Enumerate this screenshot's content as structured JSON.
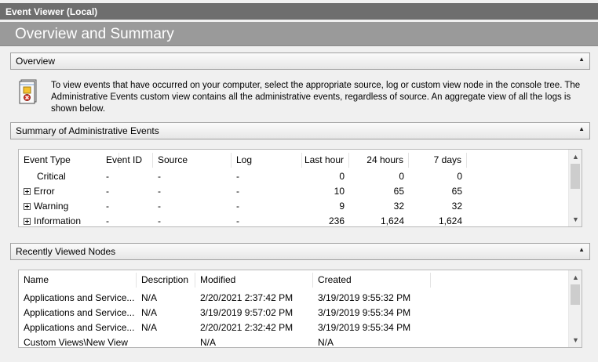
{
  "window": {
    "title": "Event Viewer (Local)"
  },
  "page": {
    "heading": "Overview and Summary"
  },
  "overview": {
    "header": "Overview",
    "icon": "event-log-icon",
    "text": "To view events that have occurred on your computer, select the appropriate source, log or custom view node in the console tree. The Administrative Events custom view contains all the administrative events, regardless of source. An aggregate view of all the logs is shown below."
  },
  "summary": {
    "header": "Summary of Administrative Events",
    "columns": [
      "Event Type",
      "Event ID",
      "Source",
      "Log",
      "Last hour",
      "24 hours",
      "7 days"
    ],
    "rows": [
      {
        "type": "Critical",
        "id": "-",
        "source": "-",
        "log": "-",
        "last_hour": "0",
        "h24": "0",
        "d7": "0",
        "expandable": false
      },
      {
        "type": "Error",
        "id": "-",
        "source": "-",
        "log": "-",
        "last_hour": "10",
        "h24": "65",
        "d7": "65",
        "expandable": true
      },
      {
        "type": "Warning",
        "id": "-",
        "source": "-",
        "log": "-",
        "last_hour": "9",
        "h24": "32",
        "d7": "32",
        "expandable": true
      },
      {
        "type": "Information",
        "id": "-",
        "source": "-",
        "log": "-",
        "last_hour": "236",
        "h24": "1,624",
        "d7": "1,624",
        "expandable": true
      }
    ]
  },
  "recent": {
    "header": "Recently Viewed Nodes",
    "columns": [
      "Name",
      "Description",
      "Modified",
      "Created"
    ],
    "rows": [
      {
        "name": "Applications and Service...",
        "description": "N/A",
        "modified": "2/20/2021 2:37:42 PM",
        "created": "3/19/2019 9:55:32 PM"
      },
      {
        "name": "Applications and Service...",
        "description": "N/A",
        "modified": "3/19/2019 9:57:02 PM",
        "created": "3/19/2019 9:55:34 PM"
      },
      {
        "name": "Applications and Service...",
        "description": "N/A",
        "modified": "2/20/2021 2:32:42 PM",
        "created": "3/19/2019 9:55:34 PM"
      },
      {
        "name": "Custom Views\\New View",
        "description": "",
        "modified": "N/A",
        "created": "N/A"
      }
    ]
  },
  "colors": {
    "title_bar": "#6e6e6e",
    "heading_bar": "#9a9a9a",
    "background": "#f0f0f0"
  }
}
